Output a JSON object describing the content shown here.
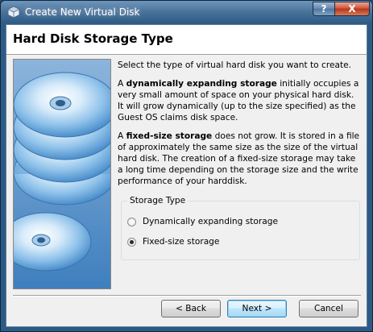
{
  "window": {
    "title": "Create New Virtual Disk",
    "help_button": "?",
    "close_button": "X"
  },
  "header": {
    "title": "Hard Disk Storage Type"
  },
  "content": {
    "intro": "Select the type of virtual hard disk you want to create.",
    "dynamic_para": {
      "prefix": "A ",
      "bold": "dynamically expanding storage",
      "rest": " initially occupies a very small amount of space on your physical hard disk. It will grow dynamically (up to the size specified) as the Guest OS claims disk space."
    },
    "fixed_para": {
      "prefix": "A ",
      "bold": "fixed-size storage",
      "rest": " does not grow. It is stored in a file of approximately the same size as the size of the virtual hard disk. The creation of a fixed-size storage may take a long time depending on the storage size and the write performance of your harddisk."
    }
  },
  "storage_type": {
    "group_label": "Storage Type",
    "options": [
      {
        "label": "Dynamically expanding storage",
        "checked": false
      },
      {
        "label": "Fixed-size storage",
        "checked": true
      }
    ]
  },
  "buttons": {
    "back_label": "< Back",
    "next_label": "Next >",
    "cancel_label": "Cancel"
  },
  "icons": {
    "app": "virtualbox-icon",
    "side_art": "disk-stack-icon"
  }
}
